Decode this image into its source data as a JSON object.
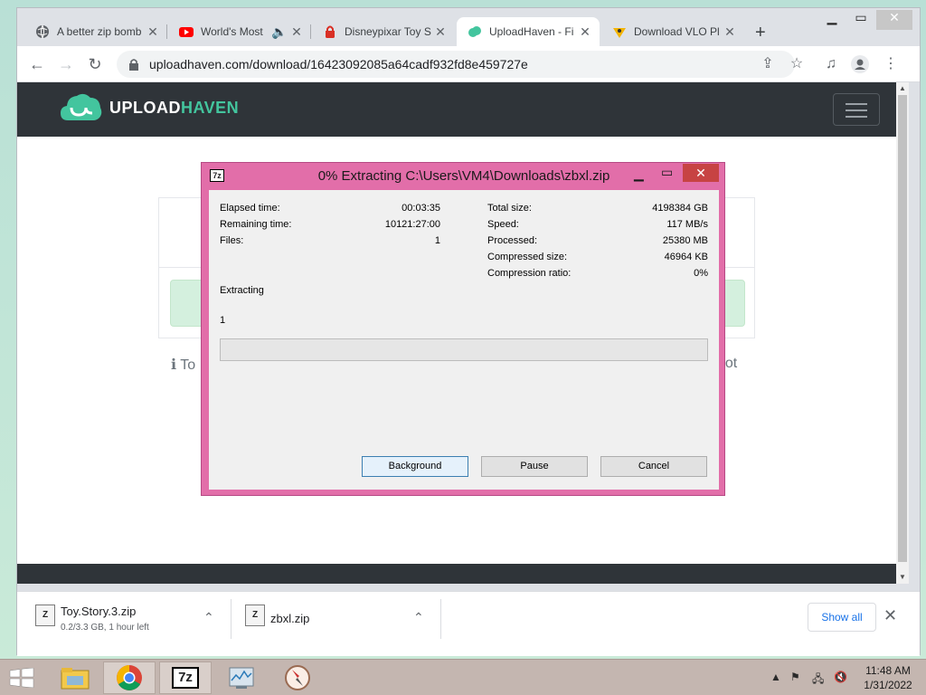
{
  "browser": {
    "tabs": [
      {
        "label": "A better zip bomb",
        "icon": "globe-icon",
        "active": false
      },
      {
        "label": "World's Most",
        "icon": "youtube-icon",
        "active": false,
        "audio": true
      },
      {
        "label": "Disneypixar Toy S",
        "icon": "lock-red-icon",
        "active": false
      },
      {
        "label": "UploadHaven - Fi",
        "icon": "uploadhaven-icon",
        "active": true
      },
      {
        "label": "Download VLO Pl",
        "icon": "vlo-icon",
        "active": false
      }
    ],
    "url": "uploadhaven.com/download/16423092085a64cadf932fd8e459727e"
  },
  "site": {
    "brand_prefix": "UPLOAD",
    "brand_suffix": "HAVEN",
    "info_left": "ℹ To",
    "info_right": "not"
  },
  "dialog": {
    "title": "0% Extracting C:\\Users\\VM4\\Downloads\\zbxl.zip",
    "icon_text": "7z",
    "left_labels": [
      "Elapsed time:",
      "Remaining time:",
      "Files:"
    ],
    "left_values": [
      "00:03:35",
      "10121:27:00",
      "1"
    ],
    "right_labels": [
      "Total size:",
      "Speed:",
      "Processed:",
      "Compressed size:",
      "Compression ratio:"
    ],
    "right_values": [
      "4198384 GB",
      "117 MB/s",
      "25380 MB",
      "46964 KB",
      "0%"
    ],
    "status": "Extracting",
    "current_file": "1",
    "progress": 0,
    "buttons": {
      "background": "Background",
      "pause": "Pause",
      "cancel": "Cancel"
    }
  },
  "downloads": [
    {
      "name": "Toy.Story.3.zip",
      "sub": "0.2/3.3 GB, 1 hour left"
    },
    {
      "name": "zbxl.zip",
      "sub": ""
    }
  ],
  "downloads_show_all": "Show all",
  "taskbar": {
    "time": "11:48 AM",
    "date": "1/31/2022"
  },
  "colors": {
    "dialog_frame": "#e26ea9",
    "brand_accent": "#43c59e",
    "header_bg": "#2f3439"
  }
}
